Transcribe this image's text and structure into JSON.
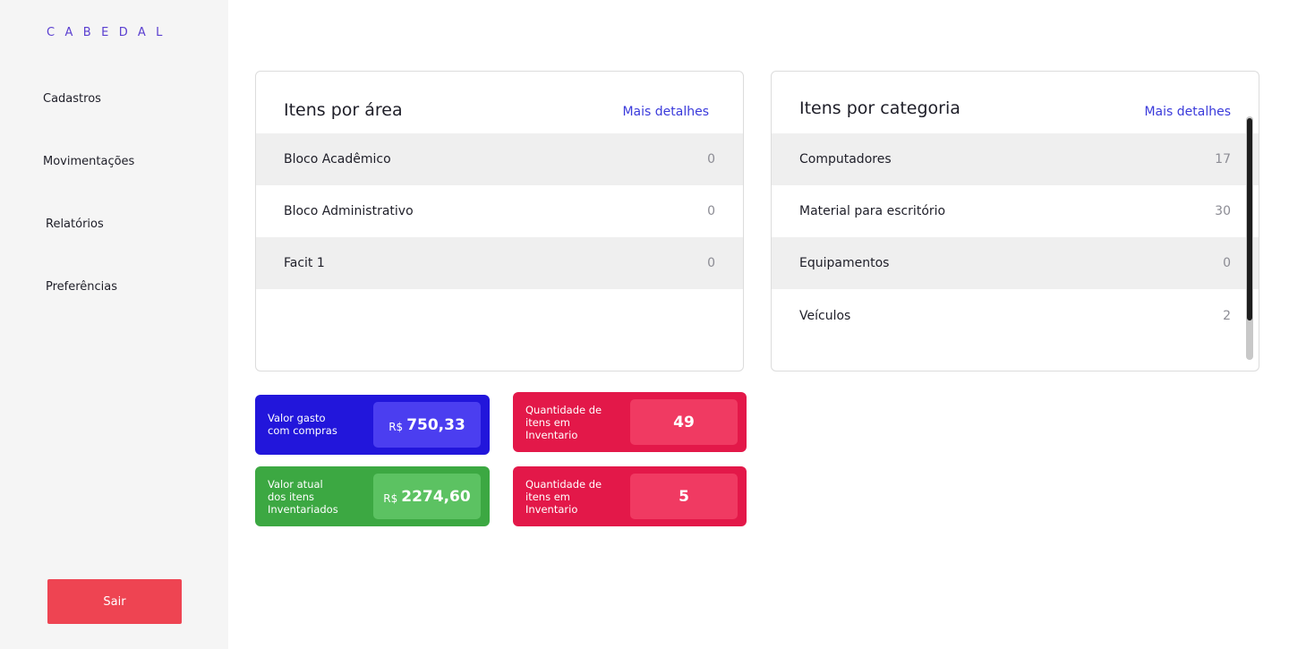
{
  "sidebar": {
    "logo": "CABEDAL",
    "nav": [
      "Cadastros",
      "Movimentações",
      "Relatórios",
      "Preferências"
    ],
    "logout_label": "Sair"
  },
  "area_panel": {
    "title": "Itens por área",
    "link": "Mais detalhes",
    "rows": [
      {
        "name": "Bloco Acadêmico",
        "value": "0"
      },
      {
        "name": "Bloco Administrativo",
        "value": "0"
      },
      {
        "name": "Facit 1",
        "value": "0"
      }
    ]
  },
  "category_panel": {
    "title": "Itens por categoria",
    "link": "Mais detalhes",
    "rows": [
      {
        "name": "Computadores",
        "value": "17"
      },
      {
        "name": "Material para escritório",
        "value": "30"
      },
      {
        "name": "Equipamentos",
        "value": "0"
      },
      {
        "name": "Veículos",
        "value": "2"
      }
    ]
  },
  "cards": [
    {
      "label": "Valor gasto\ncom compras",
      "currency": "R$",
      "value": "750,33",
      "color": "#2216db"
    },
    {
      "label": "Valor atual\ndos itens\nInventariados",
      "currency": "R$",
      "value": "2274,60",
      "color": "#3ca842"
    },
    {
      "label": "Quantidade de\nitens em\nInventario",
      "value": "49",
      "color": "#e31849"
    },
    {
      "label": "Quantidade de\nitens em\nInventario",
      "value": "5",
      "color": "#e31849"
    }
  ],
  "colors": {
    "brand": "#5a3fd0",
    "link": "#3a3adb",
    "logout": "#ee4452"
  }
}
